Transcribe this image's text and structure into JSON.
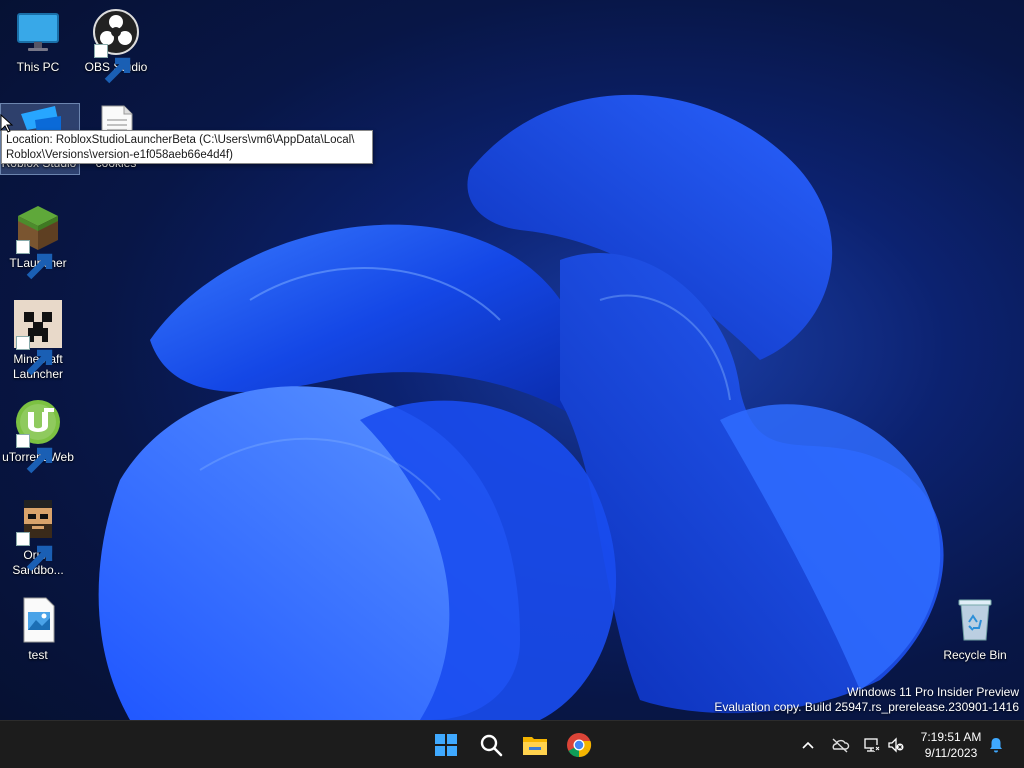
{
  "desktop": {
    "icons": [
      {
        "label": "This PC",
        "icon": "monitor-icon"
      },
      {
        "label": "OBS Studio",
        "icon": "obs-icon"
      },
      {
        "label": "Roblox Studio",
        "icon": "roblox-studio-icon"
      },
      {
        "label": "cookies",
        "icon": "text-file-icon"
      },
      {
        "label": "TLauncher",
        "icon": "grass-block-icon"
      },
      {
        "label": "Minecraft\nLauncher",
        "icon": "creeper-icon"
      },
      {
        "label": "uTorrent Web",
        "icon": "utorrent-icon"
      },
      {
        "label": "Orion\nSandbo...",
        "icon": "orion-sandbox-icon"
      },
      {
        "label": "test",
        "icon": "image-file-icon"
      },
      {
        "label": "Recycle Bin",
        "icon": "recycle-bin-icon"
      }
    ]
  },
  "tooltip": {
    "line1": "Location: RobloxStudioLauncherBeta (C:\\Users\\vm6\\AppData\\Local\\",
    "line2": "Roblox\\Versions\\version-e1f058aeb66e4d4f)"
  },
  "watermark": {
    "line1": "Windows 11 Pro Insider Preview",
    "line2": "Evaluation copy. Build 25947.rs_prerelease.230901-1416"
  },
  "taskbar": {
    "apps": [
      "start-icon",
      "search-icon",
      "file-explorer-icon",
      "chrome-icon"
    ],
    "tray": [
      "chevron-up-icon",
      "onedrive-icon",
      "network-icon",
      "volume-muted-icon",
      "notification-bell-icon"
    ],
    "time": "7:19:51 AM",
    "date": "9/11/2023"
  },
  "colors": {
    "accent": "#1e5bff",
    "taskbar": "#1c1c1c"
  }
}
